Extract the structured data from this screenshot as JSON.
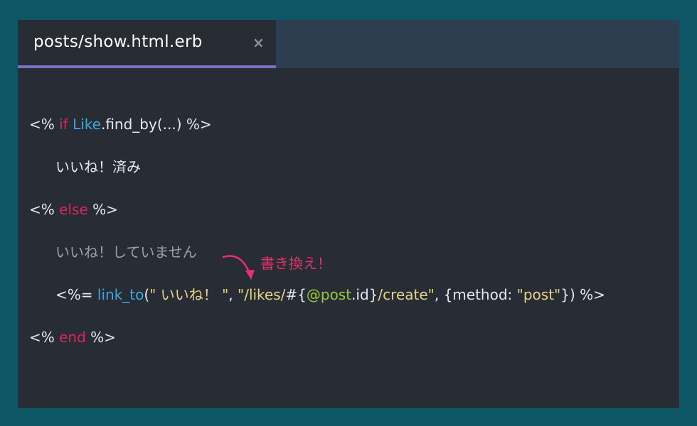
{
  "tab": {
    "title": "posts/show.html.erb",
    "close_glyph": "×"
  },
  "code": {
    "line1": {
      "open": "<% ",
      "kw": "if",
      "space": " ",
      "cls": "Like",
      "rest": ".find_by(...) %>"
    },
    "line2": {
      "text": "いいね！済み"
    },
    "line3": {
      "open": "<% ",
      "kw": "else",
      "close": " %>"
    },
    "line4": {
      "text": "いいね！していません"
    },
    "line5": {
      "open": "<%= ",
      "fn": "link_to",
      "paren": "(",
      "str1": "\" いいね！ \"",
      "comma1": ", ",
      "str2a": "\"/likes/",
      "interp_open": "#{",
      "ivar": "@post",
      "dot_id": ".id",
      "interp_close": "}",
      "str2b": "/create\"",
      "comma2": ", ",
      "hash_open": "{method: ",
      "str3": "\"post\"",
      "close": "}) %>"
    },
    "line6": {
      "open": "<% ",
      "kw": "end",
      "close": " %>"
    }
  },
  "annotation": {
    "text": "書き換え！"
  },
  "colors": {
    "background": "#0c5665",
    "editor": "#282c34",
    "tabbar": "#2c3e50",
    "tab_underline": "#7e6fc4",
    "keyword": "#d7275a",
    "class_fn": "#3aa8e0",
    "string": "#e6d486",
    "ivar": "#9ac93b",
    "annotation": "#e8306c"
  }
}
